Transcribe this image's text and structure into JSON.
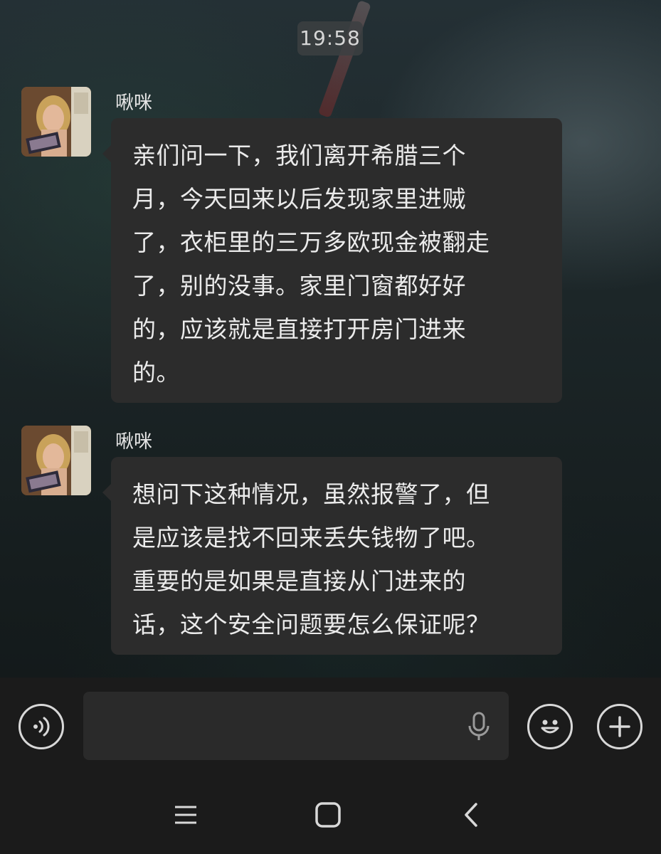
{
  "status": {
    "time": "19:58"
  },
  "messages": [
    {
      "sender": "啾咪",
      "lines": [
        "亲们问一下，我们离开希腊三个",
        "月，今天回来以后发现家里进贼",
        "了，衣柜里的三万多欧现金被翻走",
        "了，别的没事。家里门窗都好好",
        "的，应该就是直接打开房门进来",
        "的。"
      ]
    },
    {
      "sender": "啾咪",
      "lines": [
        "想问下这种情况，虽然报警了，但",
        "是应该是找不回来丢失钱物了吧。",
        "重要的是如果是直接从门进来的",
        "话，这个安全问题要怎么保证呢？"
      ]
    }
  ],
  "input_bar": {
    "voice_toggle_icon": "voice-wave-icon",
    "mic_icon": "microphone-icon",
    "emoji_icon": "smiley-icon",
    "more_icon": "plus-icon",
    "placeholder": ""
  },
  "nav_bar": {
    "recents_icon": "menu-lines-icon",
    "home_icon": "square-home-icon",
    "back_icon": "chevron-left-icon"
  },
  "colors": {
    "bubble": "#2c2c2c",
    "bubble_text": "#ebebeb",
    "bar_background": "#1b1b1b",
    "icon": "#d8d8d8"
  }
}
